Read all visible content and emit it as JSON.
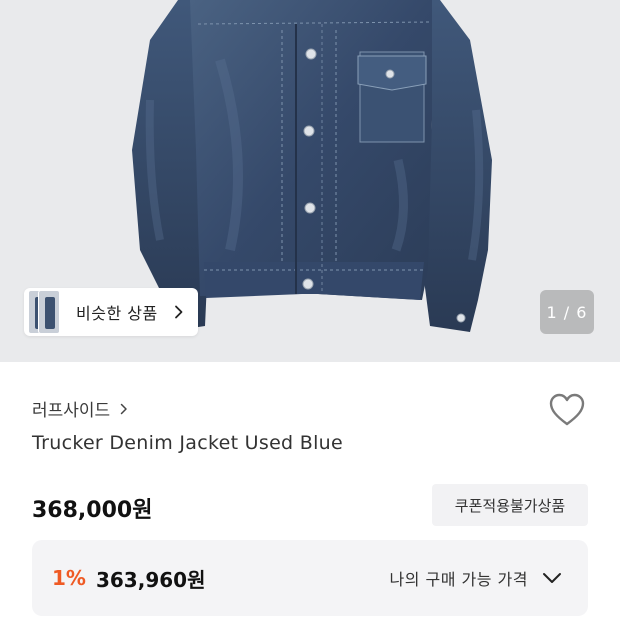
{
  "gallery": {
    "similar_label": "비슷한 상품",
    "pager": "1 / 6",
    "image_subject": "denim jacket"
  },
  "product": {
    "brand": "러프사이드",
    "name": "Trucker Denim Jacket Used Blue",
    "price": "368,000원",
    "coupon_badge": "쿠폰적용불가상품",
    "discount": "1%",
    "final_price": "363,960원",
    "my_price_label": "나의 구매 가능 가격"
  },
  "icons": {
    "wishlist": "heart-icon",
    "brand_link": "chevron-right-icon",
    "similar_link": "chevron-right-icon",
    "expand": "chevron-down-icon"
  },
  "colors": {
    "accent_discount": "#ef5a24",
    "denim": "#3e5674",
    "background_hero": "#e9eaec"
  }
}
